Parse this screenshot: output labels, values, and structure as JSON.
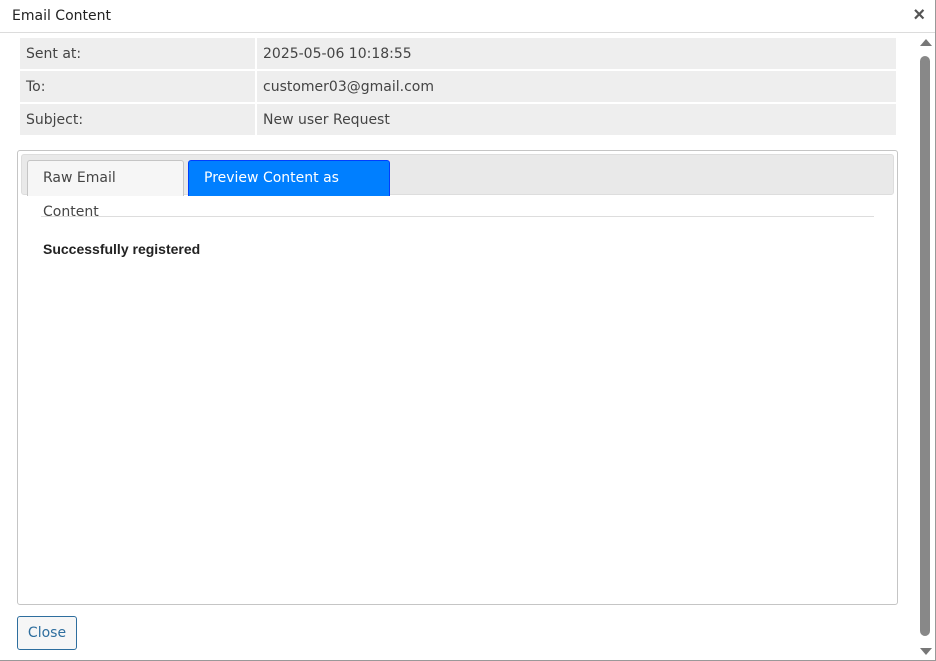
{
  "dialog": {
    "title": "Email Content",
    "close_icon": "×"
  },
  "meta": {
    "sent_label": "Sent at:",
    "sent_value": "2025-05-06 10:18:55",
    "to_label": "To:",
    "to_value": "customer03@gmail.com",
    "subject_label": "Subject:",
    "subject_value": "New user Request"
  },
  "tabs": {
    "raw": "Raw Email Content",
    "preview": "Preview Content as HTML"
  },
  "preview": {
    "body": "Successfully registered"
  },
  "footer": {
    "close_label": "Close"
  }
}
